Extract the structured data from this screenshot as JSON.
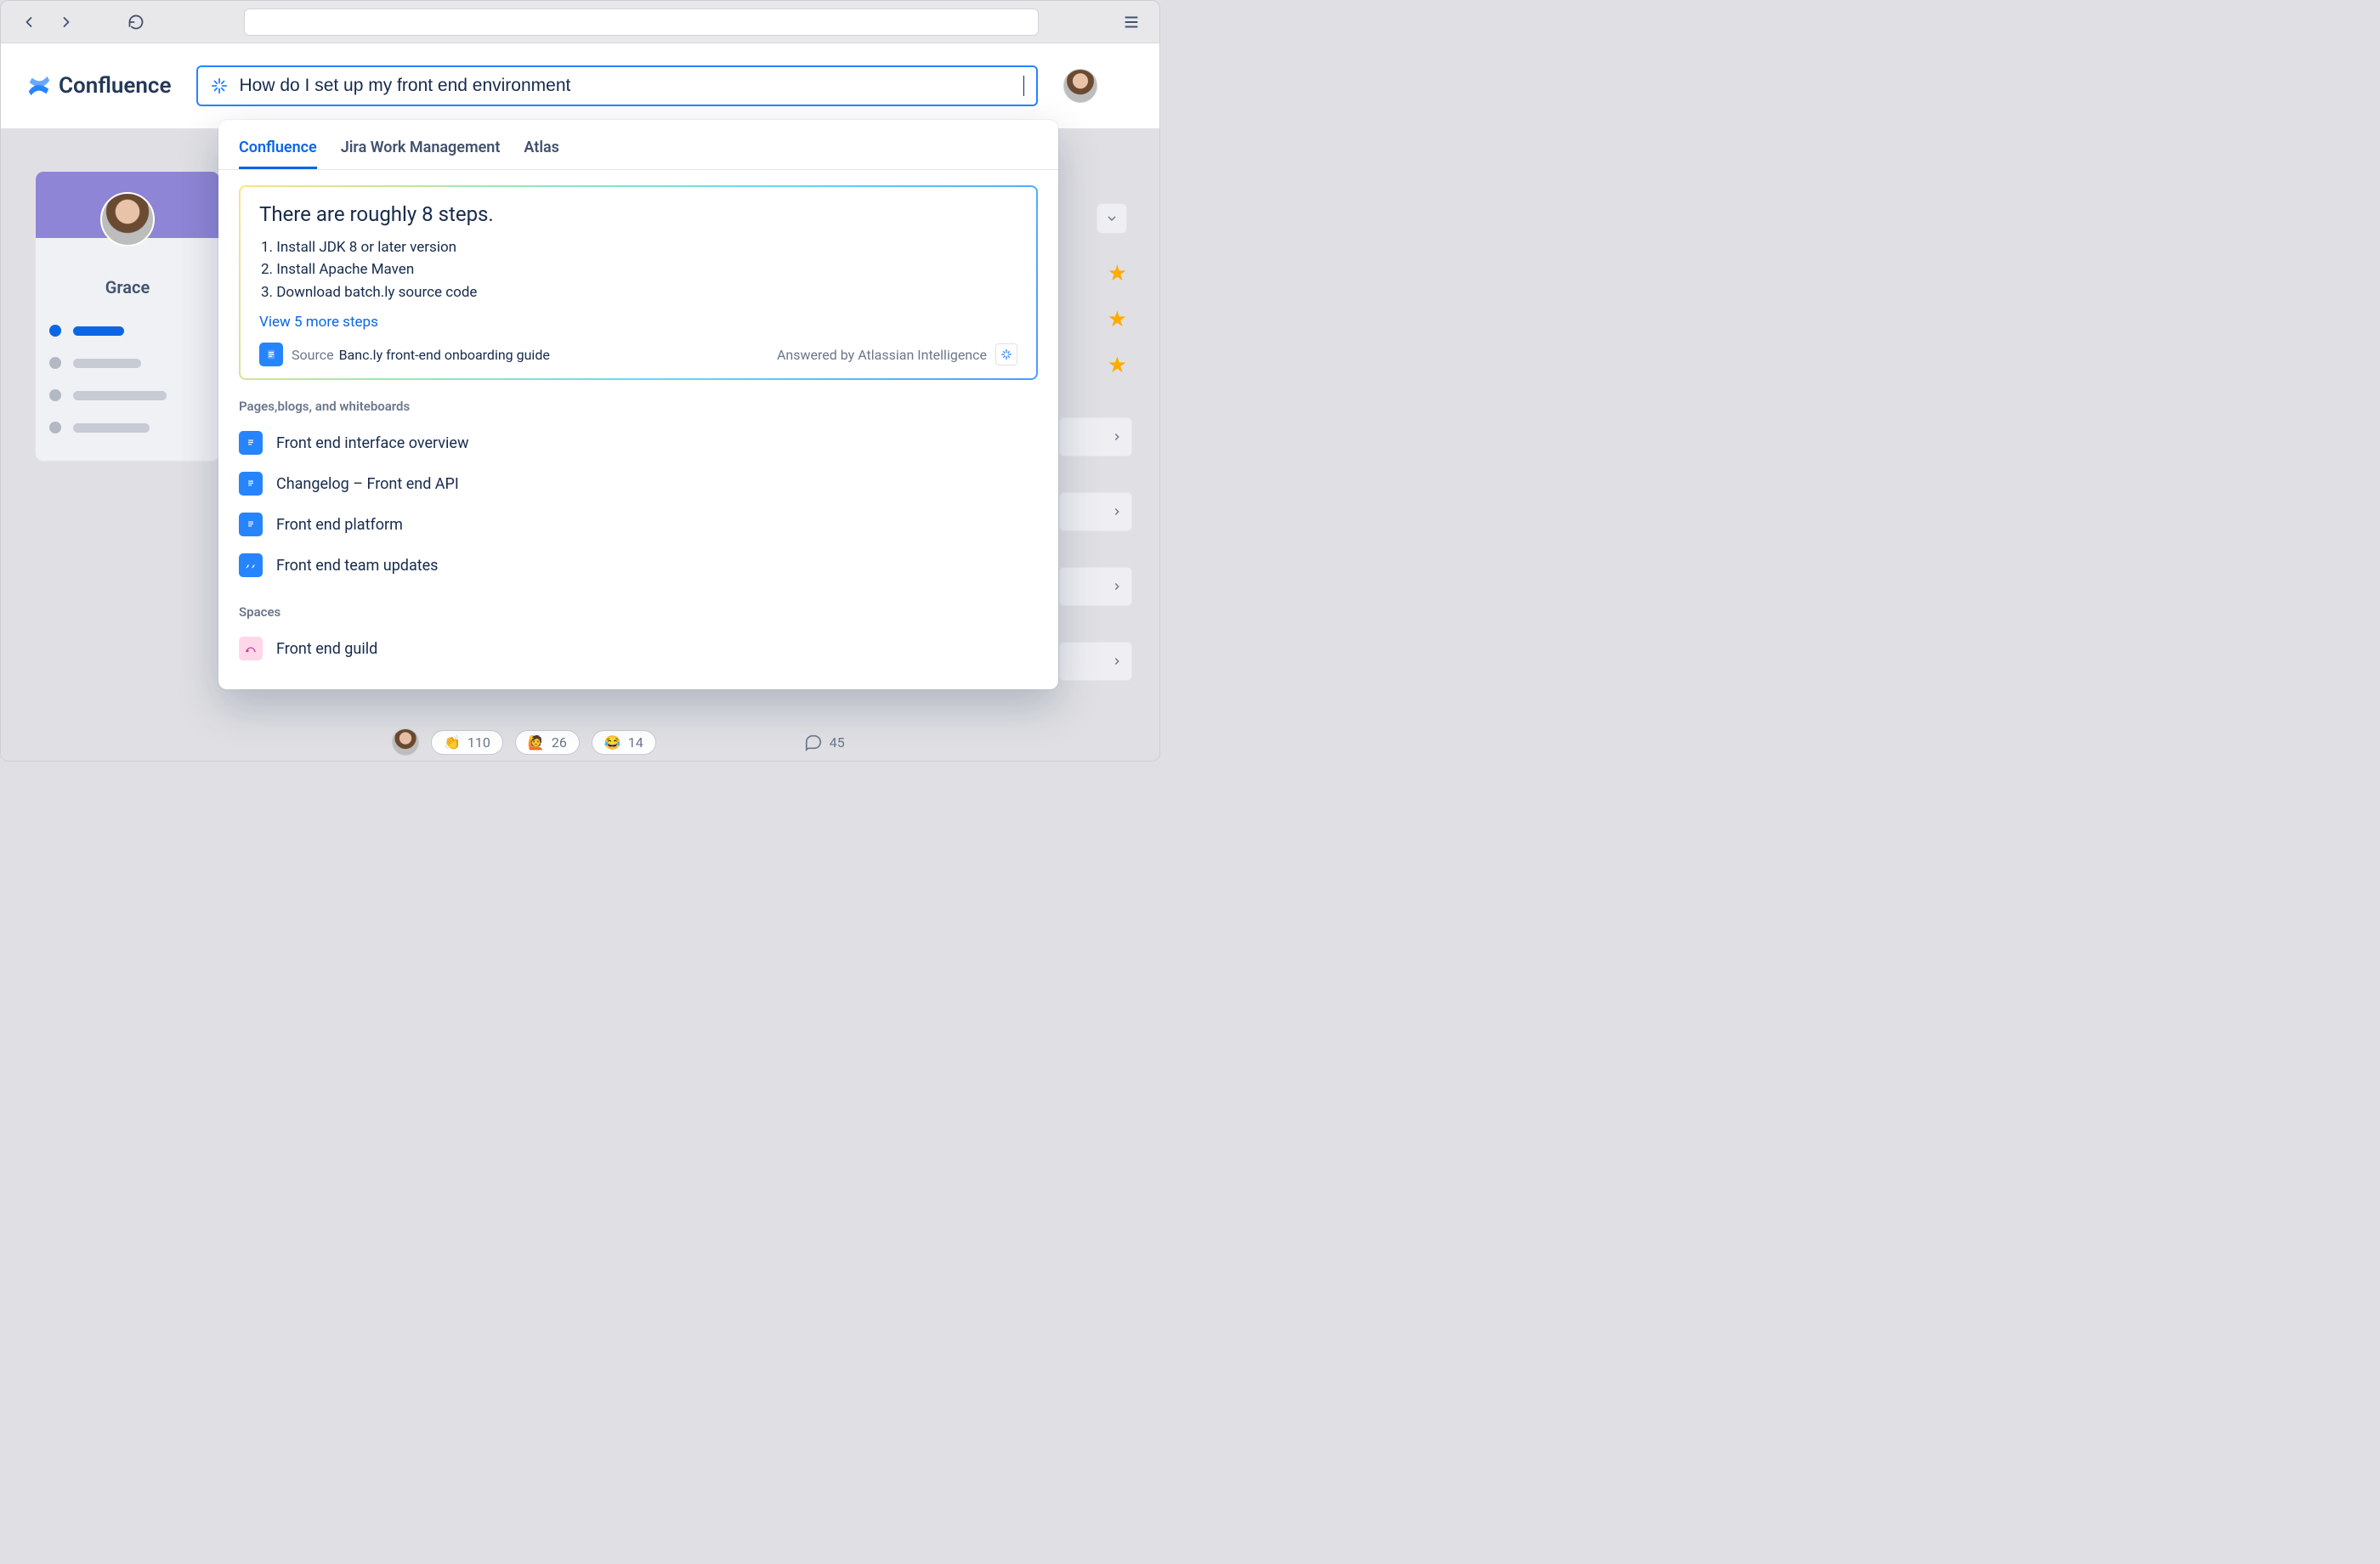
{
  "browser": {
    "url": ""
  },
  "app": {
    "product_name": "Confluence",
    "search": {
      "value": "How do I set up my front end environment",
      "placeholder": "Search"
    }
  },
  "sidebar": {
    "user_name": "Grace"
  },
  "dropdown": {
    "tabs": [
      {
        "label": "Confluence",
        "active": true
      },
      {
        "label": "Jira Work Management",
        "active": false
      },
      {
        "label": "Atlas",
        "active": false
      }
    ],
    "ai": {
      "headline": "There are roughly 8 steps.",
      "steps": [
        "Install JDK 8 or later version",
        "Install Apache Maven",
        "Download batch.ly  source code"
      ],
      "view_more": "View 5 more steps",
      "source_label": "Source",
      "source_title": "Banc.ly front-end onboarding guide",
      "answered_by": "Answered by Atlassian Intelligence"
    },
    "section_pages_label": "Pages,blogs, and whiteboards",
    "results_pages": [
      {
        "type": "page",
        "title": "Front end interface overview"
      },
      {
        "type": "page",
        "title": "Changelog – Front end API"
      },
      {
        "type": "page",
        "title": "Front end platform"
      },
      {
        "type": "blog",
        "title": "Front end team updates"
      }
    ],
    "section_spaces_label": "Spaces",
    "results_spaces": [
      {
        "title": "Front end guild"
      }
    ]
  },
  "reactions": {
    "items": [
      {
        "emoji": "👏",
        "count": "110"
      },
      {
        "emoji": "🙋",
        "count": "26"
      },
      {
        "emoji": "😂",
        "count": "14"
      }
    ],
    "comments": "45"
  }
}
